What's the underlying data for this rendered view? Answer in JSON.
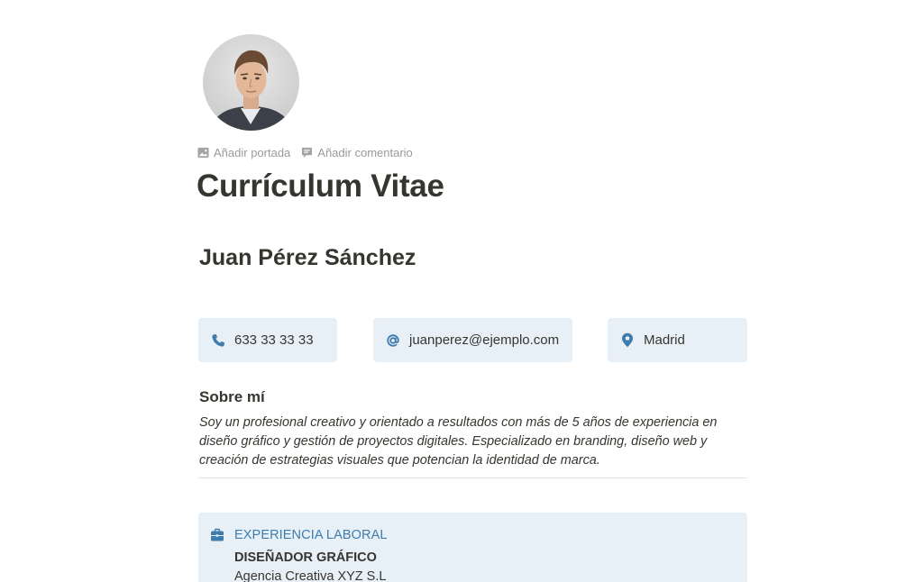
{
  "page_actions": {
    "add_cover": "Añadir portada",
    "add_comment": "Añadir comentario"
  },
  "title": "Currículum Vitae",
  "name": "Juan Pérez Sánchez",
  "contact": {
    "phone": "633 33 33 33",
    "email": "juanperez@ejemplo.com",
    "location": "Madrid"
  },
  "about": {
    "heading": "Sobre mí",
    "text": "Soy un profesional creativo y orientado a resultados con más de 5 años de experiencia en diseño gráfico y gestión de proyectos digitales. Especializado en branding, diseño web y creación de estrategias visuales que potencian la identidad de marca."
  },
  "experience": {
    "heading": "EXPERIENCIA LABORAL",
    "job_title": "DISEÑADOR GRÁFICO",
    "company": "Agencia Creativa XYZ S.L"
  },
  "icons": {
    "phone": "phone-icon",
    "email": "at-icon",
    "location": "map-pin-icon",
    "experience": "briefcase-icon",
    "cover": "image-icon",
    "comment": "comment-icon"
  },
  "colors": {
    "accent": "#3f7bab",
    "card_background": "#e7f0f7",
    "text": "#37352f",
    "muted": "#9b9a97"
  }
}
